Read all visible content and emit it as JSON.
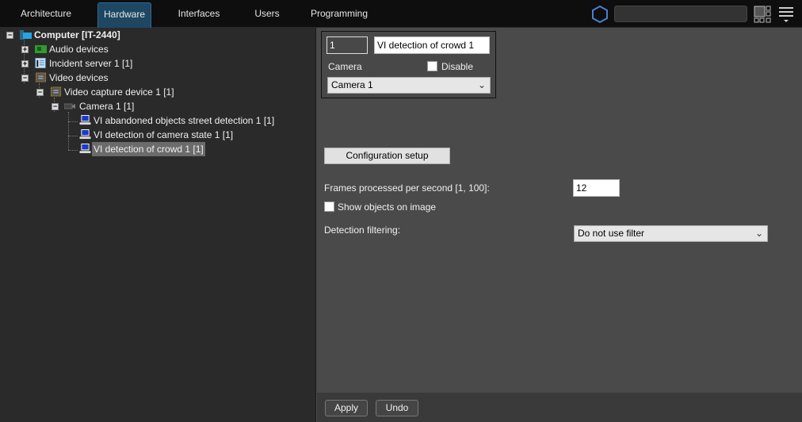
{
  "tabs": [
    {
      "label": "Architecture"
    },
    {
      "label": "Hardware"
    },
    {
      "label": "Interfaces"
    },
    {
      "label": "Users"
    },
    {
      "label": "Programming"
    }
  ],
  "search": {
    "value": ""
  },
  "tree": [
    {
      "label": "Computer [IT-2440]",
      "icon": "computer-icon"
    },
    {
      "label": "Audio devices",
      "icon": "audio-card-icon"
    },
    {
      "label": "Incident server 1 [1]",
      "icon": "server-icon"
    },
    {
      "label": "Video devices",
      "icon": "chip-icon"
    },
    {
      "label": "Video capture device 1 [1]",
      "icon": "chip-icon"
    },
    {
      "label": "Camera 1 [1]",
      "icon": "camera-icon"
    },
    {
      "label": "VI abandoned objects street detection 1 [1]",
      "icon": "monitor-icon"
    },
    {
      "label": "VI detection of camera state 1 [1]",
      "icon": "monitor-icon"
    },
    {
      "label": "VI detection of crowd 1 [1]",
      "icon": "monitor-icon"
    }
  ],
  "object": {
    "id": "1",
    "name": "VI detection of crowd 1",
    "camera_label": "Camera",
    "disable_label": "Disable",
    "camera_value": "Camera 1"
  },
  "settings": {
    "config_button": "Configuration setup",
    "fps_label": "Frames processed per second [1, 100]:",
    "fps_value": "12",
    "show_objects_label": "Show objects on image",
    "filter_label": "Detection filtering:",
    "filter_value": "Do not use filter"
  },
  "footer": {
    "apply": "Apply",
    "undo": "Undo"
  },
  "colors": {
    "active_tab": "#1d4763",
    "hex_logo": "#4a7fd0"
  }
}
